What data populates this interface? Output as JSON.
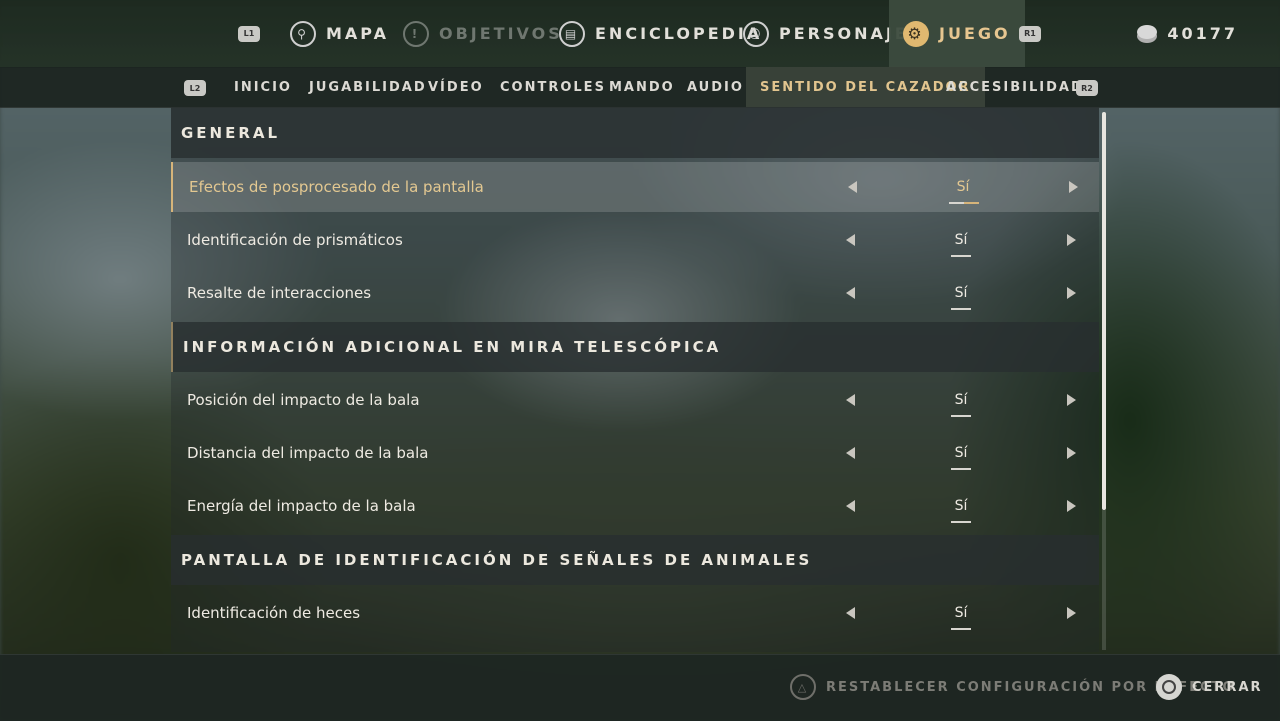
{
  "top_nav": {
    "left_trigger": "L1",
    "right_trigger": "R1",
    "items": [
      {
        "label": "MAPA",
        "icon": "map-pin-icon"
      },
      {
        "label": "OBJETIVOS",
        "icon": "exclamation-icon"
      },
      {
        "label": "ENCICLOPEDIA",
        "icon": "book-icon"
      },
      {
        "label": "PERSONAJE",
        "icon": "person-icon"
      },
      {
        "label": "JUEGO",
        "icon": "gear-icon"
      }
    ],
    "currency": "40177"
  },
  "sub_nav": {
    "left_trigger": "L2",
    "right_trigger": "R2",
    "tabs": [
      {
        "label": "INICIO"
      },
      {
        "label": "JUGABILIDAD"
      },
      {
        "label": "VÍDEO"
      },
      {
        "label": "CONTROLES"
      },
      {
        "label": "MANDO"
      },
      {
        "label": "AUDIO"
      },
      {
        "label": "SENTIDO DEL CAZADOR"
      },
      {
        "label": "ACCESIBILIDAD"
      }
    ]
  },
  "sections": [
    {
      "title": "GENERAL",
      "rows": [
        {
          "label": "Efectos de posprocesado de la pantalla",
          "value": "Sí"
        },
        {
          "label": "Identificación de prismáticos",
          "value": "Sí"
        },
        {
          "label": "Resalte de interacciones",
          "value": "Sí"
        }
      ]
    },
    {
      "title": "INFORMACIÓN ADICIONAL EN MIRA TELESCÓPICA",
      "rows": [
        {
          "label": "Posición del impacto de la bala",
          "value": "Sí"
        },
        {
          "label": "Distancia del impacto de la bala",
          "value": "Sí"
        },
        {
          "label": "Energía del impacto de la bala",
          "value": "Sí"
        }
      ]
    },
    {
      "title": "PANTALLA DE IDENTIFICACIÓN DE SEÑALES DE ANIMALES",
      "rows": [
        {
          "label": "Identificación de heces",
          "value": "Sí"
        }
      ]
    }
  ],
  "footer": {
    "reset_label": "RESTABLECER CONFIGURACIÓN POR DEFECTO",
    "close_label": "CERRAR"
  },
  "colors": {
    "accent": "#e2c58f",
    "selected_border": "#d6b47a"
  }
}
